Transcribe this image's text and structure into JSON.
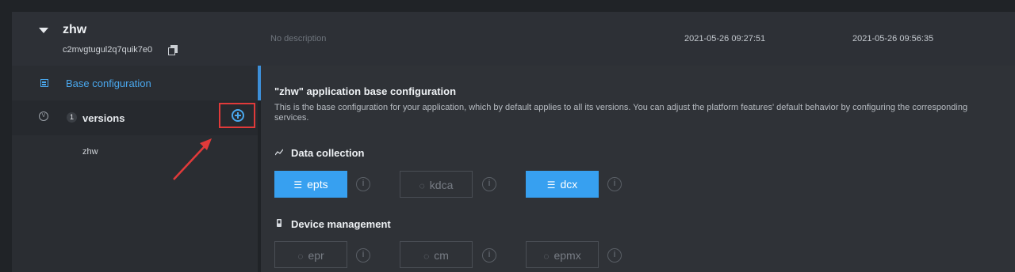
{
  "app": {
    "name": "zhw",
    "id": "c2mvgtugul2q7quik7e0",
    "description": "No description",
    "created": "2021-05-26 09:27:51",
    "updated": "2021-05-26 09:56:35"
  },
  "sidebar": {
    "base_label": "Base configuration",
    "versions_count": "1",
    "versions_label": "versions",
    "version_items": [
      "zhw"
    ]
  },
  "main": {
    "title": "\"zhw\" application base configuration",
    "description": "This is the base configuration for your application, which by default applies to all its versions. You can adjust the platform features' default behavior by configuring the corresponding services.",
    "sections": [
      {
        "title": "Data collection",
        "icon": "trend-line-icon",
        "services": [
          {
            "label": "epts",
            "enabled": true
          },
          {
            "label": "kdca",
            "enabled": false
          },
          {
            "label": "dcx",
            "enabled": true
          }
        ]
      },
      {
        "title": "Device management",
        "icon": "device-icon",
        "services": [
          {
            "label": "epr",
            "enabled": false
          },
          {
            "label": "cm",
            "enabled": false
          },
          {
            "label": "epmx",
            "enabled": false
          }
        ]
      }
    ]
  },
  "colors": {
    "accent": "#37a0f0",
    "highlight_box": "#e03a3a"
  }
}
